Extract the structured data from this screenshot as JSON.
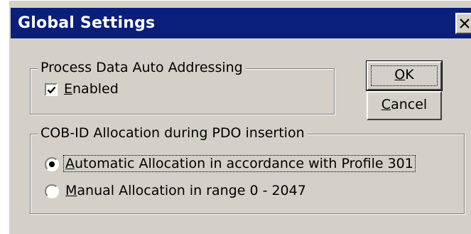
{
  "window": {
    "title": "Global Settings",
    "close_label": "X"
  },
  "process_data_group": {
    "legend": "Process Data Auto Addressing",
    "enabled_checkbox": {
      "label_underlined": "E",
      "label_rest": "nabled",
      "checked": true
    }
  },
  "cobid_group": {
    "legend": "COB-ID Allocation during PDO insertion",
    "options": [
      {
        "label_underlined": "A",
        "label_rest": "utomatic Allocation in accordance with Profile 301",
        "selected": true
      },
      {
        "label_underlined": "M",
        "label_rest": "anual Allocation in range 0 - 2047",
        "selected": false
      }
    ]
  },
  "buttons": {
    "ok": {
      "label_underlined": "O",
      "label_rest": "K"
    },
    "cancel": {
      "label_underlined": "C",
      "label_rest": "ancel"
    }
  },
  "colors": {
    "titlebar": "#0a1f7a",
    "face": "#d4d0c8"
  }
}
